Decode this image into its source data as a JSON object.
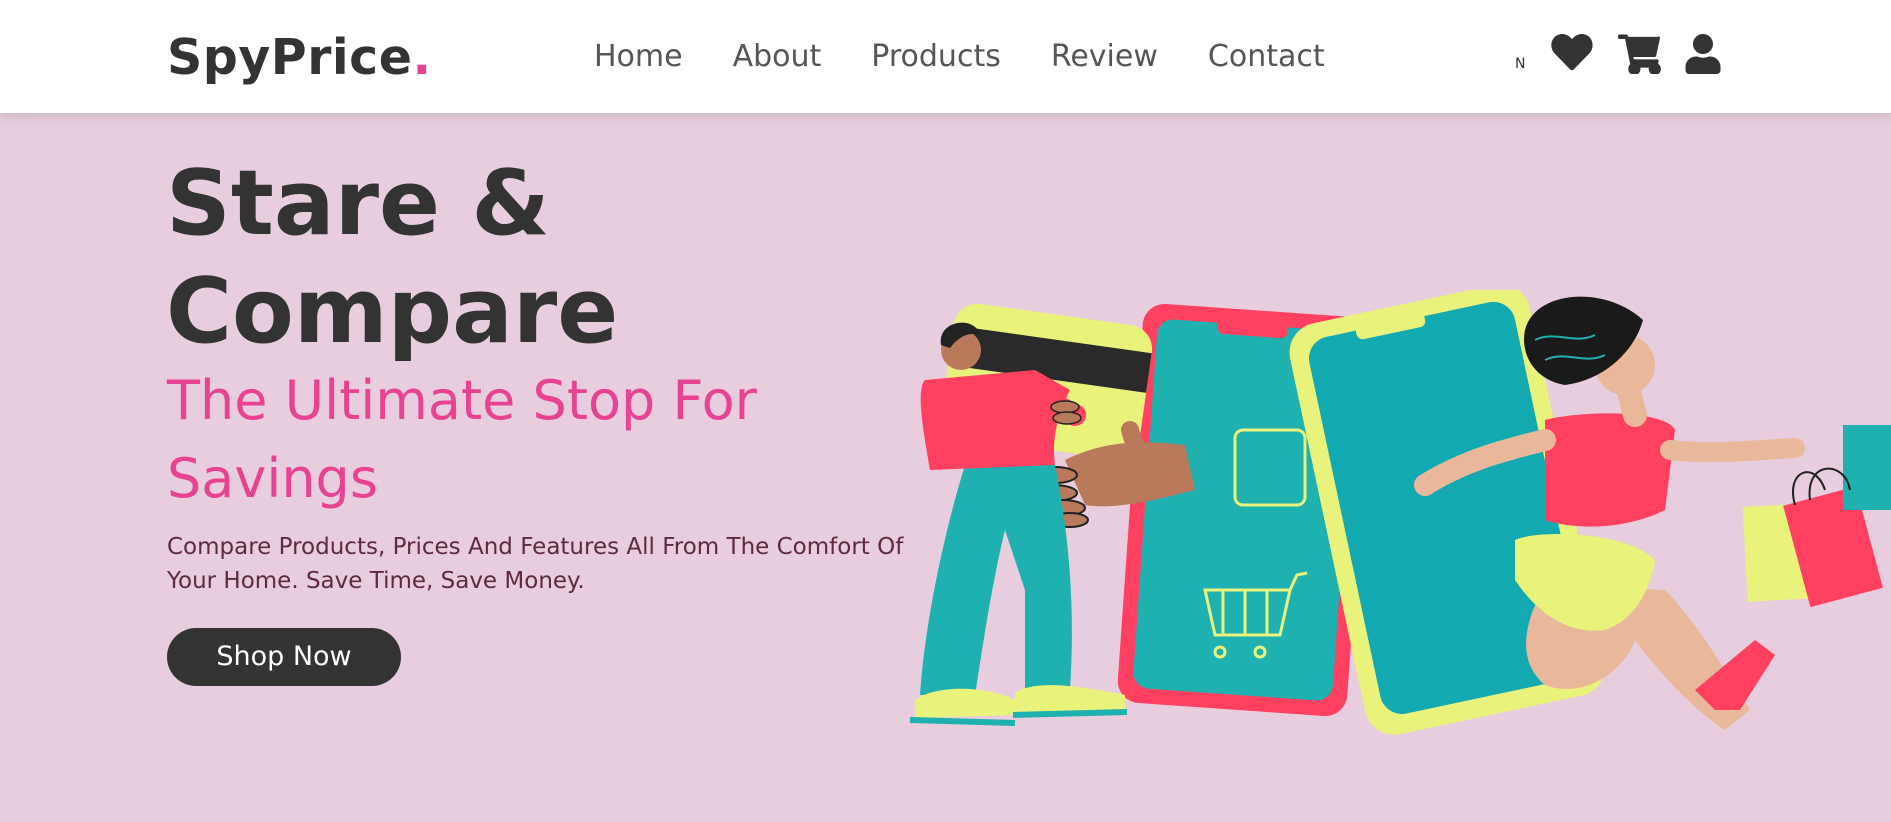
{
  "header": {
    "logo_text": "SpyPrice",
    "logo_dot": ".",
    "nav": [
      "Home",
      "About",
      "Products",
      "Review",
      "Contact"
    ],
    "icon_text": "N",
    "icons": [
      "heart-icon",
      "cart-icon",
      "user-icon"
    ]
  },
  "hero": {
    "title_line1": "Stare &",
    "title_line2": "Compare",
    "subtitle": "The Ultimate Stop For Savings",
    "description": "Compare Products, Prices And Features All From The Comfort Of Your Home. Save Time, Save Money.",
    "button_label": "Shop Now"
  },
  "colors": {
    "accent": "#e84393",
    "background": "#e7cddd",
    "dark": "#333333",
    "illustration_pink": "#ff4060",
    "illustration_teal": "#1fb0b0",
    "illustration_yellow": "#e9f27a"
  }
}
